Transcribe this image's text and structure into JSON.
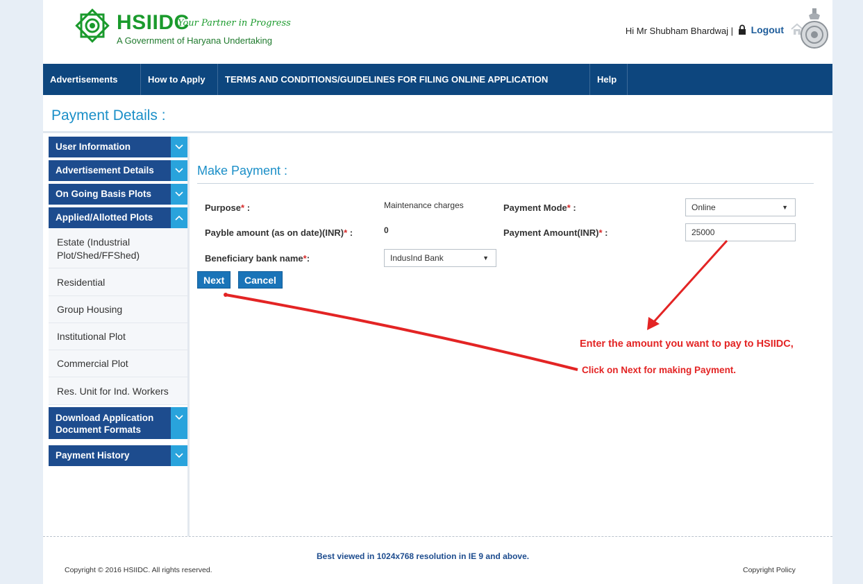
{
  "header": {
    "logo_text": "HSIIDC",
    "tagline": "Your Partner in Progress",
    "subtitle": "A Government of Haryana Undertaking",
    "greeting": "Hi Mr Shubham Bhardwaj |",
    "logout": "Logout",
    "icons": [
      "lock-icon",
      "home-icon",
      "emblem"
    ]
  },
  "nav": {
    "items": [
      {
        "label": "Advertisements"
      },
      {
        "label": "How to Apply"
      },
      {
        "label": "TERMS AND CONDITIONS/GUIDELINES FOR FILING ONLINE APPLICATION"
      },
      {
        "label": "Help"
      }
    ]
  },
  "page": {
    "title": "Payment Details :"
  },
  "sidebar": {
    "heads": [
      {
        "label": "User Information"
      },
      {
        "label": "Advertisement Details"
      },
      {
        "label": "On Going Basis Plots"
      },
      {
        "label": "Applied/Allotted Plots"
      },
      {
        "label_line1": "Download Application",
        "label_line2": "Document Formats"
      },
      {
        "label": "Payment History"
      }
    ],
    "sub_items": [
      {
        "line1": "Estate (Industrial",
        "line2": "Plot/Shed/FFShed)"
      },
      {
        "label": "Residential"
      },
      {
        "label": "Group Housing"
      },
      {
        "label": "Institutional Plot"
      },
      {
        "label": "Commercial Plot"
      },
      {
        "label": "Res. Unit for Ind. Workers"
      }
    ]
  },
  "form": {
    "section_title": "Make Payment :",
    "purpose_label": "Purpose",
    "purpose_value": "Maintenance charges",
    "payment_mode_label": "Payment Mode",
    "payment_mode_value": "Online",
    "payable_label": "Payble amount (as on date)(INR)",
    "payable_value": "0",
    "payment_amount_label": "Payment Amount(INR)",
    "payment_amount_value": "25000",
    "bank_label": "Beneficiary bank name",
    "bank_value": "IndusInd Bank",
    "required_mark": "*",
    "colon": " :",
    "colon_short": ":",
    "next_button": "Next",
    "cancel_button": "Cancel"
  },
  "annotations": {
    "line1": "Enter the amount you want to pay to HSIIDC,",
    "line2": "Click on Next  for making Payment.",
    "color": "#e32424"
  },
  "footer": {
    "best_viewed": "Best viewed in 1024x768 resolution in IE 9 and above.",
    "copyright": "Copyright © 2016 HSIIDC. All rights reserved.",
    "policy": "Copyright Policy"
  },
  "colors": {
    "nav_bg": "#0d467e",
    "sidebar_head": "#1d4c8e",
    "chevron_bg": "#29a3dc",
    "title_blue": "#1b8fc8",
    "button": "#1a74b8",
    "logo_green": "#1a9a2c"
  }
}
